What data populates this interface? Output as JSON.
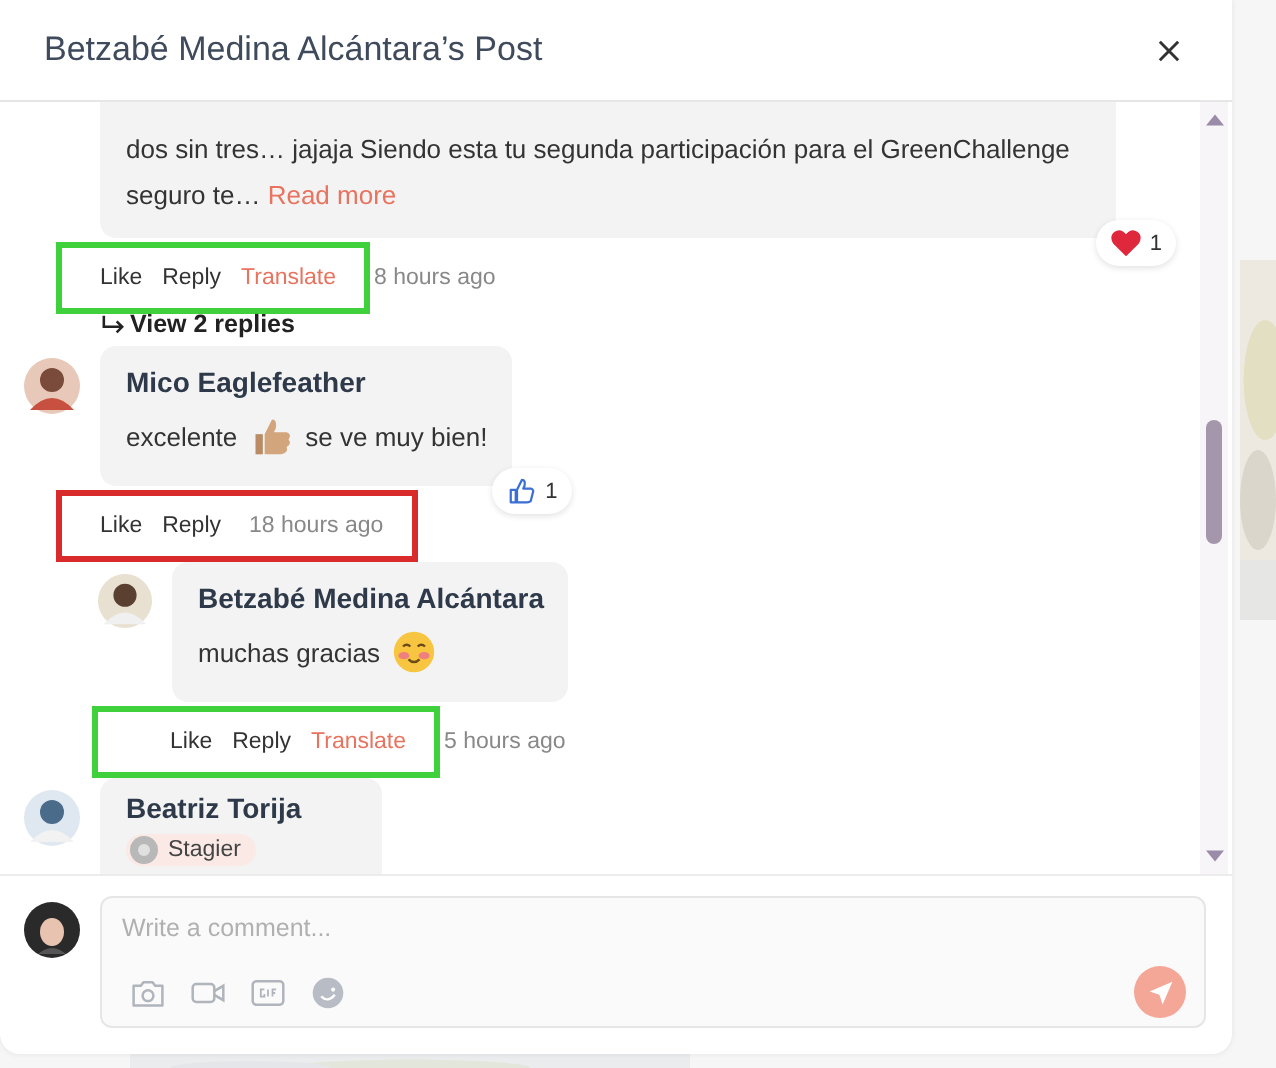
{
  "dialog": {
    "title": "Betzabé Medina Alcántara’s Post"
  },
  "comments": [
    {
      "text": "dos sin tres… jajaja Siendo esta tu segunda participación para el GreenChallenge seguro te…",
      "read_more": "Read more",
      "reaction": {
        "kind": "heart",
        "count": "1"
      },
      "actions": [
        {
          "label": "Like",
          "kind": "plain"
        },
        {
          "label": "Reply",
          "kind": "plain"
        },
        {
          "label": "Translate",
          "kind": "translate"
        }
      ],
      "time": "8 hours ago",
      "highlight": {
        "color": "#3fd13b",
        "time_inside": false
      },
      "view_replies": "View 2 replies"
    },
    {
      "avatar": {
        "kind": "picture"
      },
      "name": "Mico Eaglefeather",
      "parts": [
        {
          "kind": "text",
          "text": "excelente"
        },
        {
          "kind": "thumbs-up"
        },
        {
          "kind": "text",
          "text": "se ve muy bien!"
        }
      ],
      "reaction": {
        "kind": "like",
        "count": "1"
      },
      "actions": [
        {
          "label": "Like",
          "kind": "plain"
        },
        {
          "label": "Reply",
          "kind": "plain"
        }
      ],
      "time": "18 hours ago",
      "highlight": {
        "color": "#d92b2b",
        "time_inside": true
      },
      "children": [
        {
          "avatar": {
            "kind": "picture"
          },
          "name": "Betzabé Medina Alcántara",
          "parts": [
            {
              "kind": "text",
              "text": "muchas gracias"
            },
            {
              "kind": "blush"
            }
          ],
          "actions": [
            {
              "label": "Like",
              "kind": "plain"
            },
            {
              "label": "Reply",
              "kind": "plain"
            },
            {
              "label": "Translate",
              "kind": "translate"
            }
          ],
          "time": "5 hours ago",
          "highlight": {
            "color": "#3fd13b",
            "time_inside": false
          }
        }
      ]
    },
    {
      "avatar": {
        "kind": "picture"
      },
      "name": "Beatriz Torija",
      "badge": "Stagier"
    }
  ],
  "composer": {
    "placeholder": "Write a comment..."
  }
}
